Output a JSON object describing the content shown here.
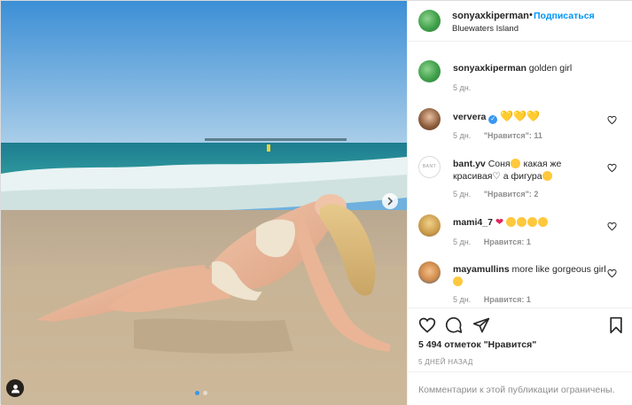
{
  "post": {
    "username": "sonyaxkiperman",
    "dot": "•",
    "follow_label": "Подписаться",
    "location": "Bluewaters Island",
    "more": "···"
  },
  "photo": {
    "dots": 2,
    "active_dot": 1
  },
  "comments": [
    {
      "user": "sonyaxkiperman",
      "text": "golden girl",
      "time": "5 дн.",
      "likes": "",
      "reply": ""
    },
    {
      "user": "ververa",
      "verified": true,
      "text": "💛💛💛",
      "time": "5 дн.",
      "likes": "\"Нравится\": 11",
      "reply": ""
    },
    {
      "user": "bant.yv",
      "text_before": "Соня",
      "text_mid": " какая же красивая",
      "text_mid2": " а фигура",
      "time": "5 дн.",
      "likes": "\"Нравится\": 2",
      "reply": ""
    },
    {
      "user": "mami4_7",
      "text": "",
      "time": "5 дн.",
      "likes": "Нравится: 1",
      "reply": ""
    },
    {
      "user": "mayamullins",
      "text": "more like gorgeous girl",
      "time": "5 дн.",
      "likes": "Нравится: 1",
      "reply": ""
    }
  ],
  "bant_avatar_text": "BANT",
  "actions": {
    "likes_count": "5 494",
    "likes_word": "отметок",
    "likes_label": "\"Нравится\"",
    "time_ago": "5 ДНЕЙ НАЗАД"
  },
  "footer": {
    "closed_text": "Комментарии к этой публикации ограничены."
  },
  "colors": {
    "accent": "#0095f6",
    "secondary_text": "#8e8e8e",
    "heart_red": "#e0245e"
  }
}
